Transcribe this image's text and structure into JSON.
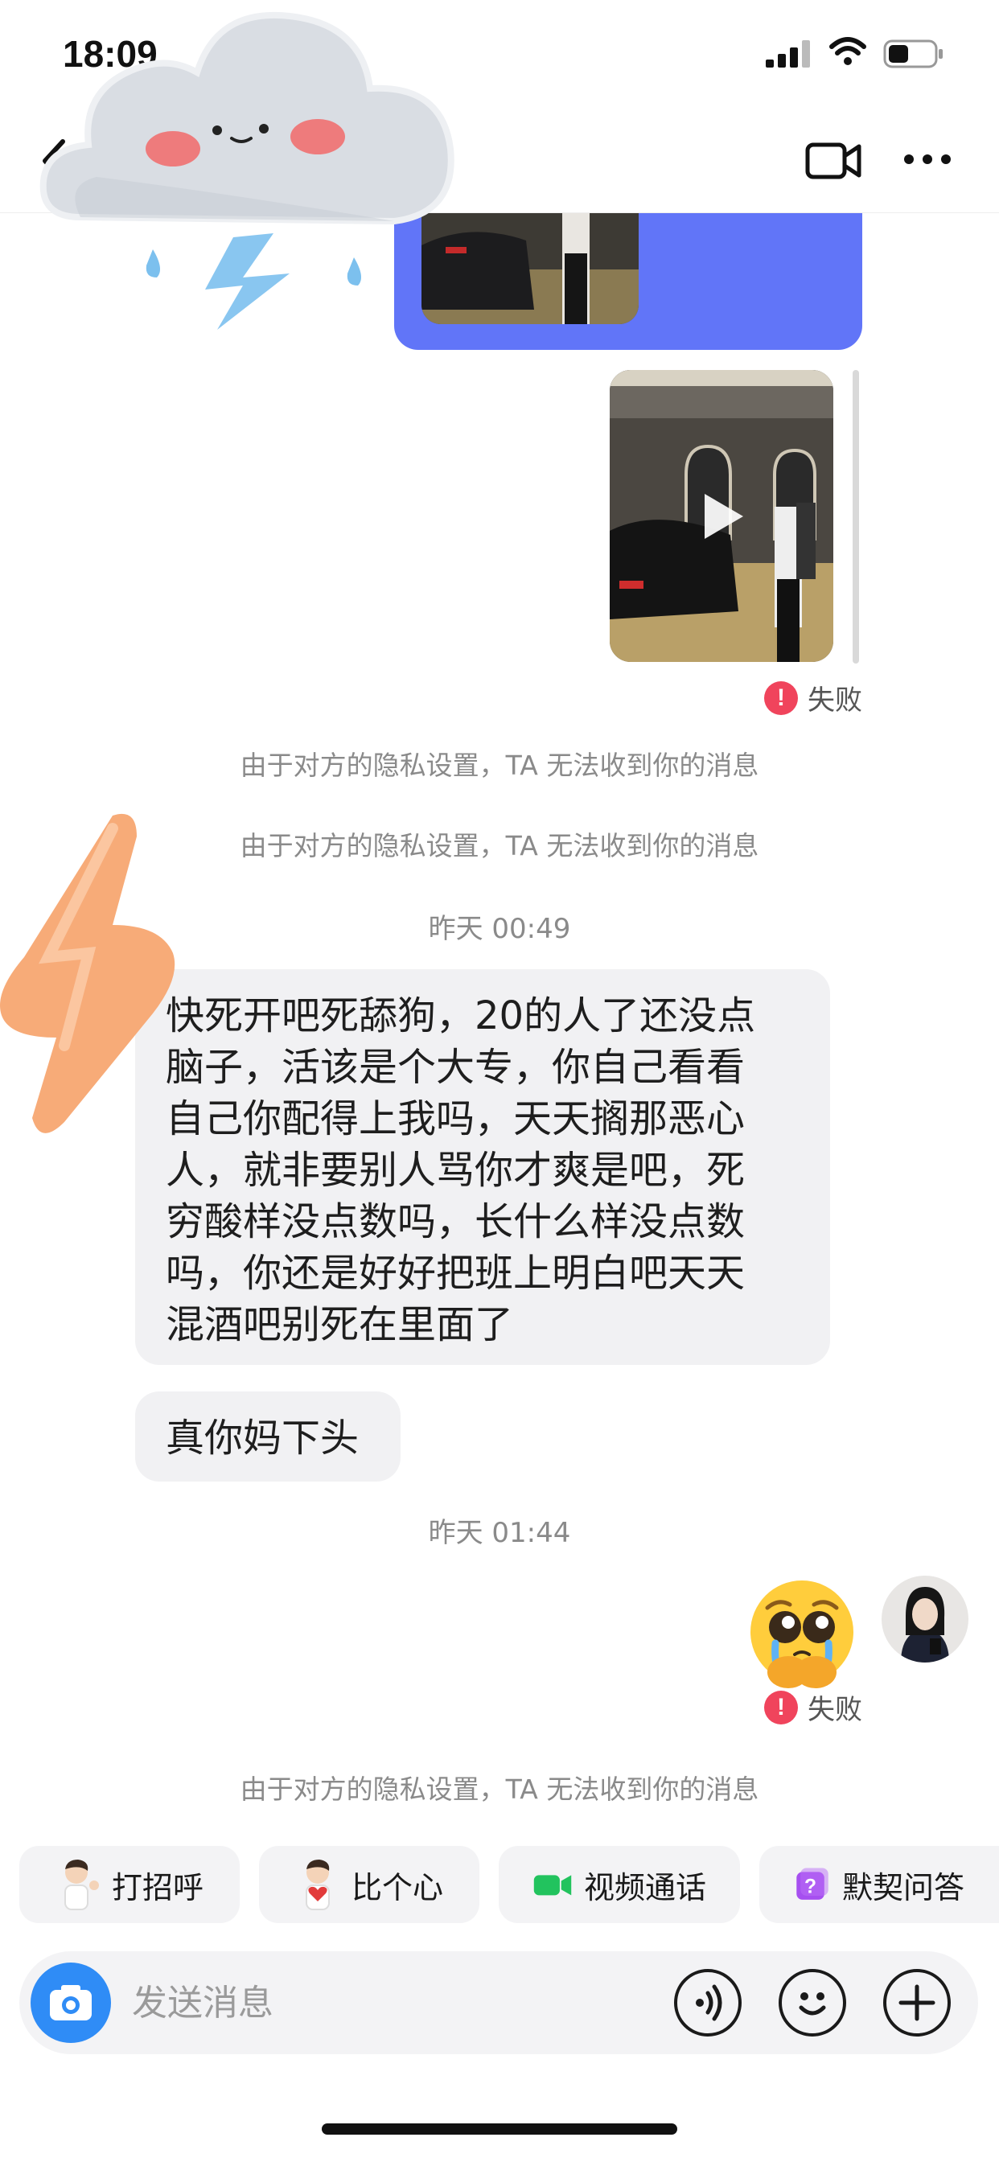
{
  "status_bar": {
    "time": "18:09"
  },
  "nav": {
    "back_icon": "chevron-left-icon",
    "video_icon": "video-camera-icon",
    "more_icon": "more-dots-icon"
  },
  "chat": {
    "video_fail_text": "失败",
    "notices": [
      "由于对方的隐私设置，TA 无法收到你的消息",
      "由于对方的隐私设置，TA 无法收到你的消息",
      "由于对方的隐私设置，TA 无法收到你的消息"
    ],
    "timestamps": [
      "昨天 00:49",
      "昨天 01:44"
    ],
    "received_messages": [
      {
        "lines": [
          "快死开吧死舔狗，20的人了还没点",
          "脑子，活该是个大专，你自己看看",
          "自己你配得上我吗，天天搁那恶心",
          "人，就非要别人骂你才爽是吧，死",
          "穷酸样没点数吗，长什么样没点数",
          "吗，你还是好好把班上明白吧天天",
          "混酒吧别死在里面了"
        ]
      },
      {
        "lines": [
          "真你妈下头"
        ]
      }
    ],
    "emoji_fail_text": "失败",
    "emoji_name": "pleading-face-emoji"
  },
  "quick_actions": [
    {
      "label": "打招呼",
      "icon": "waving-person-icon"
    },
    {
      "label": "比个心",
      "icon": "heart-person-icon"
    },
    {
      "label": "视频通话",
      "icon": "video-call-icon"
    },
    {
      "label": "默契问答",
      "icon": "question-icon"
    }
  ],
  "input": {
    "placeholder": "发送消息"
  },
  "colors": {
    "sent_bubble": "#6175f8",
    "fail_red": "#f0445c",
    "camera_blue": "#2f8cf6",
    "video_green": "#22c35e",
    "question_purple": "#a64ff0"
  }
}
